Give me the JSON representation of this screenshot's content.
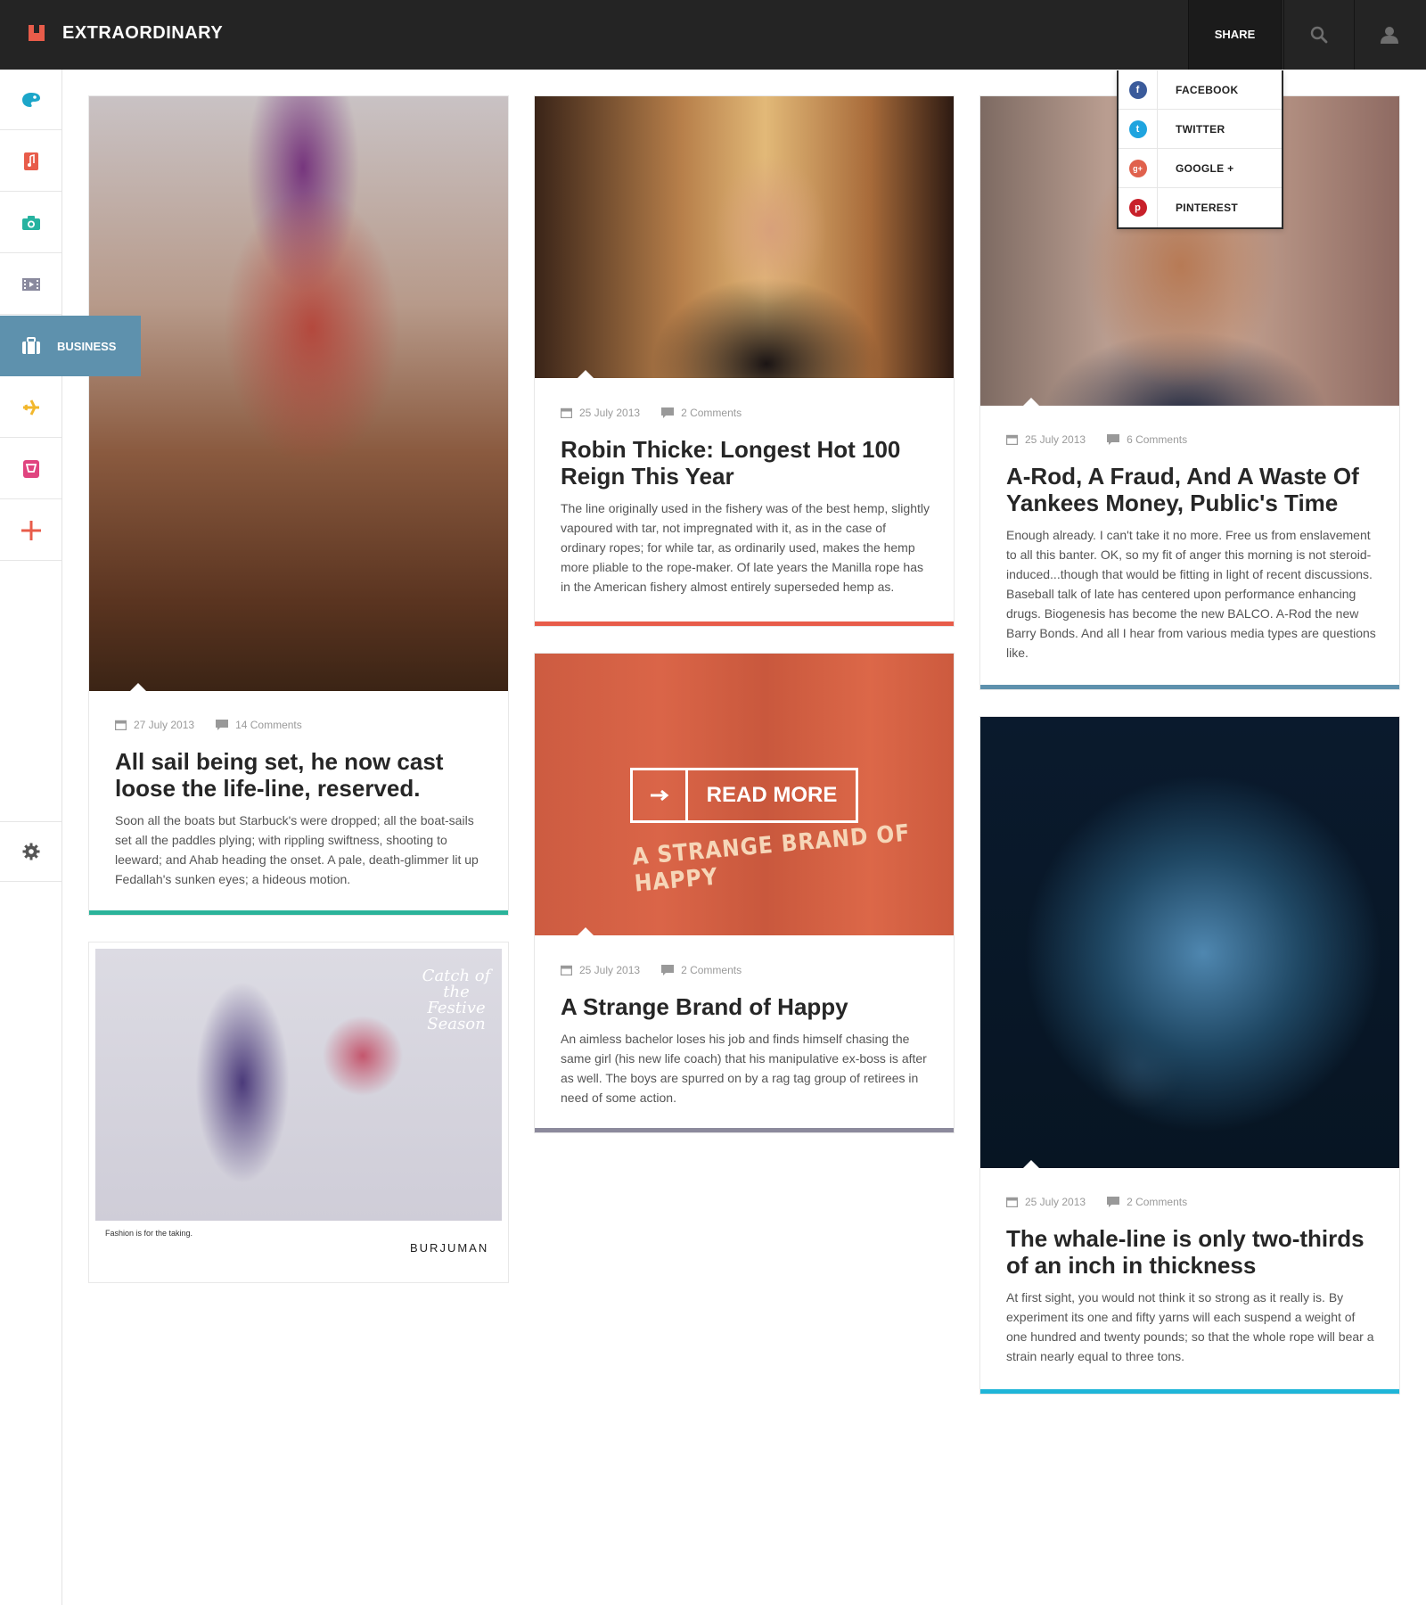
{
  "header": {
    "brand": "EXTRAORDINARY",
    "share_label": "SHARE",
    "search_icon": "search-icon",
    "user_icon": "user-icon"
  },
  "share_menu": {
    "items": [
      {
        "label": "FACEBOOK",
        "icon": "facebook-icon",
        "glyph": "f",
        "color": "#3b5b9b"
      },
      {
        "label": "TWITTER",
        "icon": "twitter-icon",
        "glyph": "t",
        "color": "#1fa4df"
      },
      {
        "label": "GOOGLE +",
        "icon": "google-plus-icon",
        "glyph": "g+",
        "color": "#e0614d"
      },
      {
        "label": "PINTEREST",
        "icon": "pinterest-icon",
        "glyph": "p",
        "color": "#c8202a"
      }
    ]
  },
  "sidebar": {
    "items": [
      {
        "icon": "palette-icon",
        "color": "#1ca6c9"
      },
      {
        "icon": "music-icon",
        "color": "#e85c4a"
      },
      {
        "icon": "camera-icon",
        "color": "#27b3a0"
      },
      {
        "icon": "film-icon",
        "color": "#8a8a9e"
      },
      {
        "icon": "briefcase-icon",
        "label": "BUSINESS",
        "active": true,
        "color": "#5e91ad"
      },
      {
        "icon": "airplane-icon",
        "color": "#f2b72c"
      },
      {
        "icon": "shopping-bag-icon",
        "color": "#e0447f"
      },
      {
        "icon": "plus-icon",
        "color": "#e85c4a"
      }
    ],
    "settings_icon": "gear-icon"
  },
  "posts": {
    "shoe": {
      "date": "27 July 2013",
      "comments": "14 Comments",
      "title": "All sail being set, he now cast loose the life-line, reserved.",
      "excerpt": "Soon all the boats but Starbuck's were dropped; all the boat-sails set all the paddles plying; with rippling swiftness, shooting to leeward; and Ahab heading the onset. A pale, death-glimmer lit up Fedallah's sunken eyes; a hideous motion.",
      "accent": "#2bb39a"
    },
    "robin": {
      "date": "25 July 2013",
      "comments": "2 Comments",
      "title": "Robin Thicke: Longest Hot 100 Reign This Year",
      "excerpt": "The line originally used in the fishery was of the best hemp, slightly vapoured with tar, not impregnated with it, as in the case of ordinary ropes; for while tar, as ordinarily used, makes the hemp more pliable to the rope-maker. Of late years the Manilla rope has in the American fishery almost entirely superseded hemp as.",
      "accent": "#e85c4a"
    },
    "arod": {
      "date": "25 July 2013",
      "comments": "6 Comments",
      "title": "A-Rod, A Fraud, And A Waste Of Yankees Money, Public's Time",
      "excerpt": "Enough already.  I can't take it no more.  Free us from enslavement to all this banter. OK, so my fit of anger this morning is not steroid-induced...though that would be fitting in light of recent discussions. Baseball talk of late has centered upon performance enhancing drugs.  Biogenesis has become the new BALCO.  A-Rod the new Barry Bonds. And all I hear from various media types are questions like.",
      "accent": "#5e91ad"
    },
    "happy": {
      "date": "25 July 2013",
      "comments": "2 Comments",
      "title": "A Strange Brand of Happy",
      "excerpt": "An aimless bachelor loses his job and finds himself chasing the same girl (his new life coach) that his manipulative ex-boss is after as well. The boys are spurred on by a rag tag group of retirees in need of some action.",
      "read_more": "READ MORE",
      "sign": "A STRANGE BRAND OF HAPPY",
      "accent": "#8c8a9c"
    },
    "planet": {
      "date": "25 July 2013",
      "comments": "2 Comments",
      "title": "The whale-line is only two-thirds of an inch in thickness",
      "excerpt": "At first sight, you would not think it so strong as it really is. By experiment its one and fifty yarns will each suspend a weight of one hundred and twenty pounds; so that the whole rope will bear a strain nearly equal to three tons.",
      "accent": "#1fb5d8"
    },
    "ad": {
      "script": "Catch of the Festive Season",
      "caption": "Fashion is for the taking.",
      "brand": "BURJUMAN"
    }
  }
}
